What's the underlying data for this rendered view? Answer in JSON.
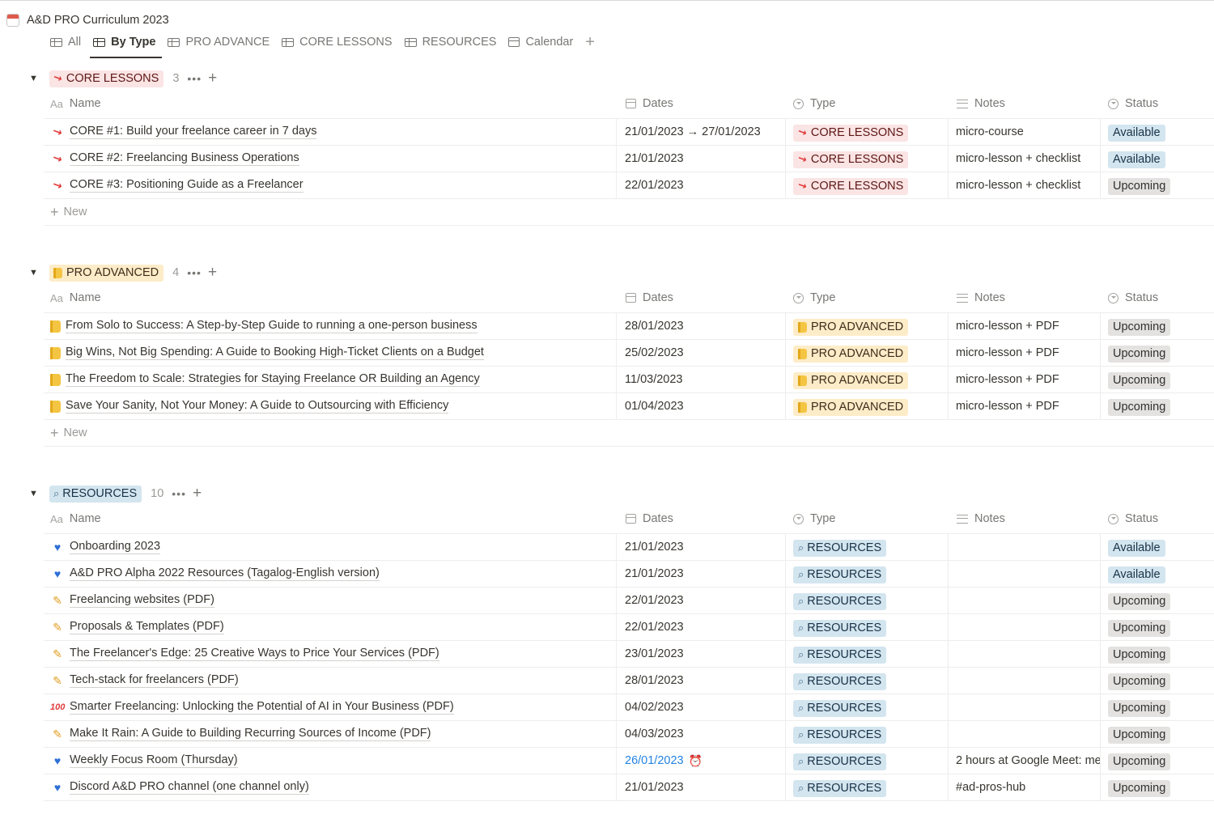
{
  "page": {
    "title": "A&D PRO Curriculum 2023",
    "icon": "calendar-icon"
  },
  "tabs": [
    {
      "label": "All",
      "icon": "table-icon",
      "active": false
    },
    {
      "label": "By Type",
      "icon": "table-icon",
      "active": true
    },
    {
      "label": "PRO ADVANCE",
      "icon": "table-icon",
      "active": false
    },
    {
      "label": "CORE LESSONS",
      "icon": "table-icon",
      "active": false
    },
    {
      "label": "RESOURCES",
      "icon": "table-icon",
      "active": false
    },
    {
      "label": "Calendar",
      "icon": "calendar-icon",
      "active": false
    }
  ],
  "columns": {
    "name": "Name",
    "name_prefix": "Aa",
    "dates": "Dates",
    "type": "Type",
    "notes": "Notes",
    "status": "Status"
  },
  "new_label": "New",
  "colors": {
    "core_bg": "#fbe4e4",
    "pro_bg": "#fdecc8",
    "res_bg": "#d3e5ef",
    "available_bg": "#d3e5ef",
    "upcoming_bg": "#e3e2e0",
    "link": "#2383e2"
  },
  "groups": [
    {
      "label": "CORE LESSONS",
      "icon": "pushpin-icon",
      "count": "3",
      "rows": [
        {
          "icon": "pushpin-icon",
          "name": "CORE #1: Build your freelance career in 7 days",
          "date": "21/01/2023 → 27/01/2023",
          "type": "CORE LESSONS",
          "notes": "micro-course",
          "status": "Available"
        },
        {
          "icon": "pushpin-icon",
          "name": "CORE #2: Freelancing Business Operations",
          "date": "21/01/2023",
          "type": "CORE LESSONS",
          "notes": "micro-lesson + checklist",
          "status": "Available"
        },
        {
          "icon": "pushpin-icon",
          "name": "CORE #3: Positioning Guide as a Freelancer",
          "date": "22/01/2023",
          "type": "CORE LESSONS",
          "notes": "micro-lesson + checklist",
          "status": "Upcoming"
        }
      ]
    },
    {
      "label": "PRO ADVANCED",
      "icon": "folder-icon",
      "count": "4",
      "rows": [
        {
          "icon": "folder-icon",
          "name": "From Solo to Success: A Step-by-Step Guide to running a one-person business",
          "date": "28/01/2023",
          "type": "PRO ADVANCED",
          "notes": "micro-lesson + PDF",
          "status": "Upcoming"
        },
        {
          "icon": "folder-icon",
          "name": "Big Wins, Not Big Spending: A Guide to Booking High-Ticket Clients on a Budget",
          "date": "25/02/2023",
          "type": "PRO ADVANCED",
          "notes": "micro-lesson + PDF",
          "status": "Upcoming"
        },
        {
          "icon": "folder-icon",
          "name": "The Freedom to Scale: Strategies for Staying Freelance OR Building an Agency",
          "date": "11/03/2023",
          "type": "PRO ADVANCED",
          "notes": "micro-lesson + PDF",
          "status": "Upcoming"
        },
        {
          "icon": "folder-icon",
          "name": "Save Your Sanity, Not Your Money: A Guide to Outsourcing with Efficiency",
          "date": "01/04/2023",
          "type": "PRO ADVANCED",
          "notes": "micro-lesson + PDF",
          "status": "Upcoming"
        }
      ]
    },
    {
      "label": "RESOURCES",
      "icon": "magnifier-icon",
      "count": "10",
      "rows": [
        {
          "icon": "blue-heart-icon",
          "name": "Onboarding 2023",
          "date": "21/01/2023",
          "type": "RESOURCES",
          "notes": "",
          "status": "Available"
        },
        {
          "icon": "blue-heart-icon",
          "name": "A&D PRO Alpha 2022 Resources (Tagalog-English version)",
          "date": "21/01/2023",
          "type": "RESOURCES",
          "notes": "",
          "status": "Available"
        },
        {
          "icon": "pencil-icon",
          "name": "Freelancing websites (PDF)",
          "date": "22/01/2023",
          "type": "RESOURCES",
          "notes": "",
          "status": "Upcoming"
        },
        {
          "icon": "pencil-icon",
          "name": "Proposals & Templates (PDF)",
          "date": "22/01/2023",
          "type": "RESOURCES",
          "notes": "",
          "status": "Upcoming"
        },
        {
          "icon": "pencil-icon",
          "name": "The Freelancer's Edge: 25 Creative Ways to Price Your Services (PDF)",
          "date": "23/01/2023",
          "type": "RESOURCES",
          "notes": "",
          "status": "Upcoming"
        },
        {
          "icon": "pencil-icon",
          "name": "Tech-stack for freelancers (PDF)",
          "date": "28/01/2023",
          "type": "RESOURCES",
          "notes": "",
          "status": "Upcoming"
        },
        {
          "icon": "hundred-icon",
          "name": "Smarter Freelancing: Unlocking the Potential of AI in Your Business (PDF)",
          "date": "04/02/2023",
          "type": "RESOURCES",
          "notes": "",
          "status": "Upcoming"
        },
        {
          "icon": "pencil-icon",
          "name": "Make It Rain: A Guide to Building Recurring Sources of Income (PDF)",
          "date": "04/03/2023",
          "type": "RESOURCES",
          "notes": "",
          "status": "Upcoming"
        },
        {
          "icon": "blue-heart-icon",
          "name": "Weekly Focus Room (Thursday)",
          "date": "26/01/2023",
          "date_reminder": true,
          "type": "RESOURCES",
          "notes": "2 hours at Google Meet: me",
          "status": "Upcoming"
        },
        {
          "icon": "blue-heart-icon",
          "name": "Discord A&D PRO channel (one channel only)",
          "date": "21/01/2023",
          "type": "RESOURCES",
          "notes": "#ad-pros-hub",
          "status": "Upcoming"
        }
      ]
    }
  ]
}
